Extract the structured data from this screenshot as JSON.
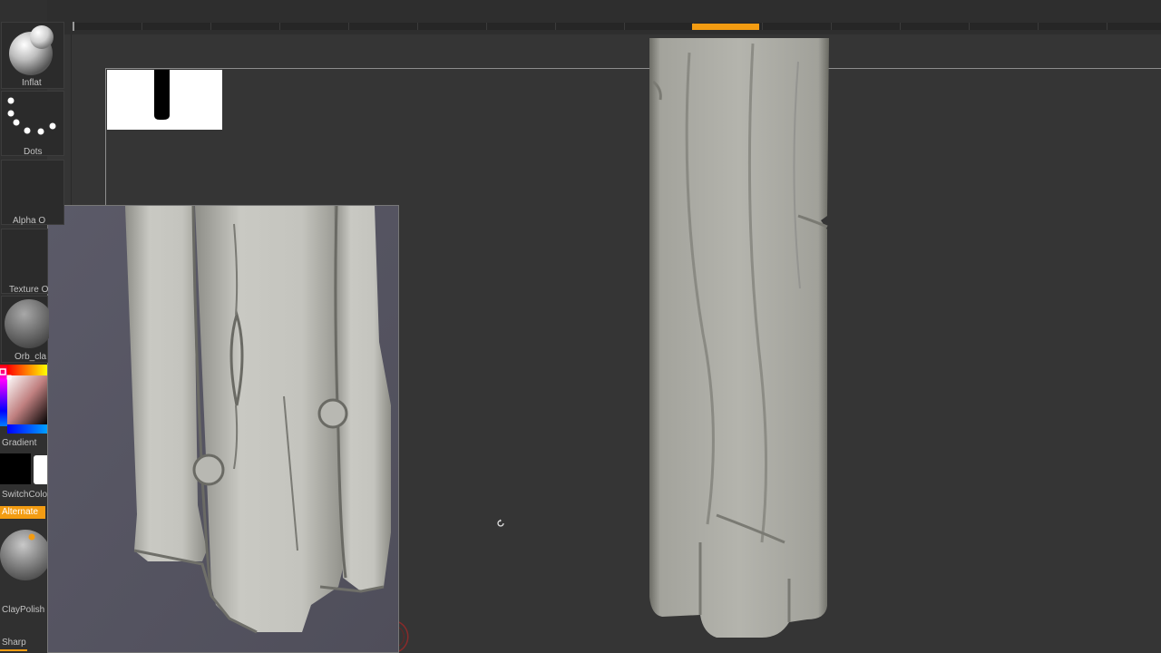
{
  "tray": {
    "brush_label": "Inflat",
    "stroke_label": "Dots",
    "alpha_label": "Alpha O",
    "texture_label": "Texture O",
    "material_label": "Orb_cla",
    "gradient_label": "Gradient",
    "switch_color_label": "SwitchColo",
    "alternate_label": "Alternate",
    "material2_label": "ClayPolish",
    "sharp_label": "Sharp"
  },
  "colors": {
    "accent": "#f39c12",
    "background": "#353535",
    "tray": "#303030"
  },
  "icons": {
    "rotate": "rotate-icon"
  }
}
